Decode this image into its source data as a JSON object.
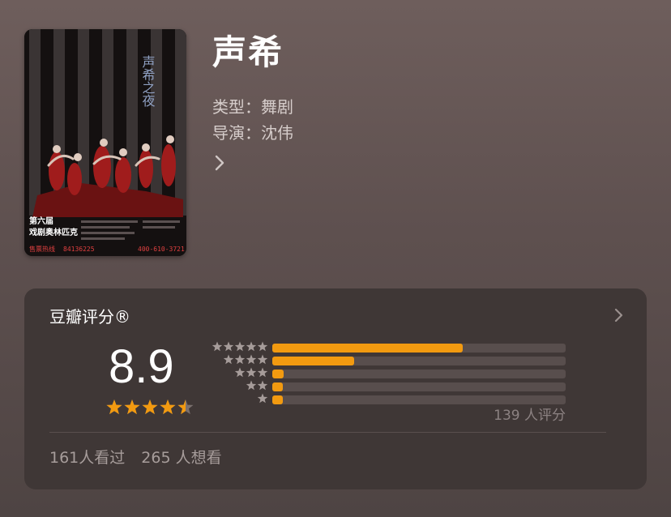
{
  "movie": {
    "title": "声希",
    "type_line": "类型：舞剧",
    "director_line": "导演：沈伟"
  },
  "poster": {
    "vertical_title": "声希之夜",
    "festival_label": "第六届",
    "festival_name": "戏剧奥林匹克",
    "hotline_label": "售票热线",
    "phone_left": "84136225",
    "phone_right": "400-610-3721"
  },
  "rating": {
    "header": "豆瓣评分®",
    "score": "8.9",
    "stars_avg": 4.5,
    "distribution_percent": [
      65,
      28,
      4,
      3,
      3
    ],
    "rating_count_label": "139 人评分",
    "watched_label": "161人看过",
    "want_label": "265 人想看"
  },
  "colors": {
    "accent": "#f29a10",
    "card_bg": "#3f3736",
    "track": "#584e4d",
    "dist_star": "#a69c9a"
  },
  "icons": {
    "detail": "chevron-right-icon",
    "star": "star-icon"
  }
}
